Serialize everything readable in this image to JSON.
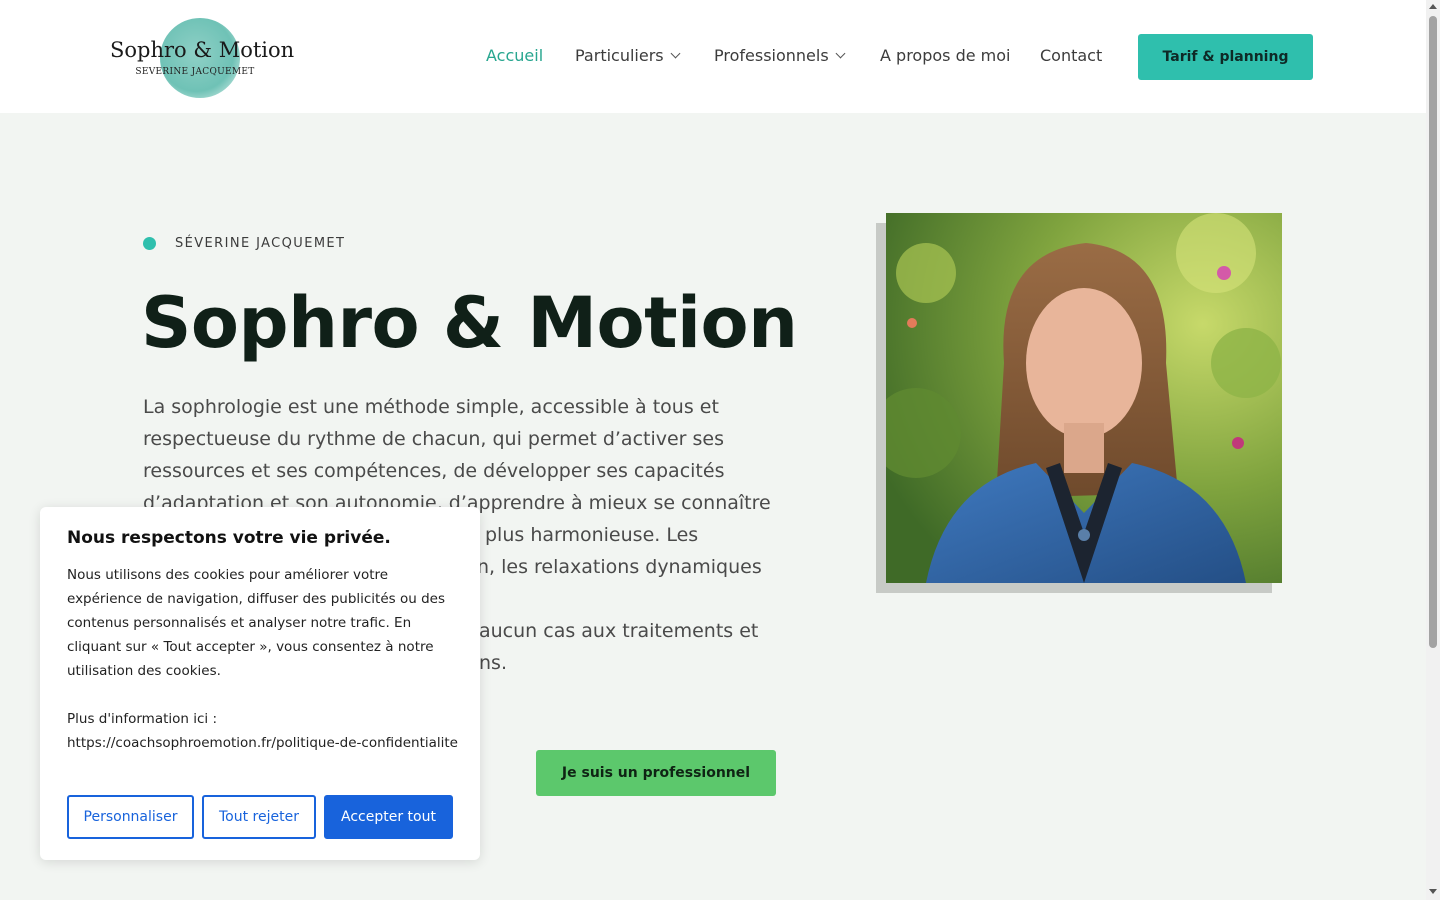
{
  "header": {
    "logo": {
      "title": "Sophro & Motion",
      "subtitle": "SEVERINE JACQUEMET"
    },
    "nav": [
      {
        "label": "Accueil",
        "active": true
      },
      {
        "label": "Particuliers",
        "dropdown": true
      },
      {
        "label": "Professionnels",
        "dropdown": true
      },
      {
        "label": "A propos de moi"
      },
      {
        "label": "Contact"
      }
    ],
    "cta_label": "Tarif & planning"
  },
  "hero": {
    "eyebrow": "SÉVERINE JACQUEMET",
    "title": "Sophro & Motion",
    "paragraph_lines": [
      "La sophrologie est une méthode simple, accessible à tous et",
      "respectueuse du rythme de chacun, qui permet d’activer ses",
      "ressources et ses compétences, de développer ses capacités",
      "d’adaptation et son autonomie, d’apprendre à mieux se connaître",
      "plus harmonieuse. Les",
      "n, les relaxations dynamiques",
      "",
      "aucun cas aux traitements et",
      "ns."
    ],
    "button_pro": "Je suis un professionnel"
  },
  "cookie_banner": {
    "title": "Nous respectons votre vie privée.",
    "text": "Nous utilisons des cookies pour améliorer votre expérience de navigation, diffuser des publicités ou des contenus personnalisés et analyser notre trafic. En cliquant sur « Tout accepter », vous consentez à notre utilisation des cookies.",
    "more_info_label": "Plus d'information ici :",
    "more_info_url": "https://coachsophroemotion.fr/politique-de-confidentialite",
    "btn_customize": "Personnaliser",
    "btn_reject": "Tout rejeter",
    "btn_accept": "Accepter tout"
  },
  "colors": {
    "accent": "#2fbfad",
    "cta_green": "#5cc86c",
    "cookie_blue": "#1863dc",
    "background": "#f2f5f2"
  }
}
